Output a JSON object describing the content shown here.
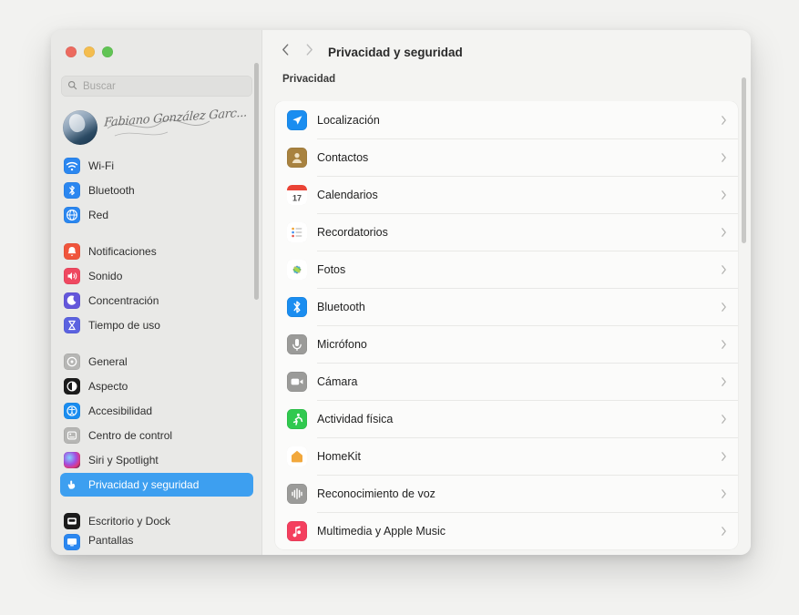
{
  "window": {
    "traffic_lights": [
      "close",
      "minimize",
      "zoom"
    ],
    "colors": {
      "close": "#ec6a5f",
      "minimize": "#f4bd4f",
      "zoom": "#61c454",
      "accent": "#3d9ff0"
    }
  },
  "sidebar": {
    "search": {
      "placeholder": "Buscar",
      "value": ""
    },
    "account": {
      "name": "Fabiano González Garc...",
      "avatar": "user-photo"
    },
    "groups": [
      {
        "items": [
          {
            "label": "Wi-Fi",
            "icon": "wifi-icon"
          },
          {
            "label": "Bluetooth",
            "icon": "bluetooth-icon"
          },
          {
            "label": "Red",
            "icon": "network-globe-icon"
          }
        ]
      },
      {
        "items": [
          {
            "label": "Notificaciones",
            "icon": "notifications-icon"
          },
          {
            "label": "Sonido",
            "icon": "sound-icon"
          },
          {
            "label": "Concentración",
            "icon": "focus-moon-icon"
          },
          {
            "label": "Tiempo de uso",
            "icon": "screen-time-icon"
          }
        ]
      },
      {
        "items": [
          {
            "label": "General",
            "icon": "general-gear-icon"
          },
          {
            "label": "Aspecto",
            "icon": "appearance-icon"
          },
          {
            "label": "Accesibilidad",
            "icon": "accessibility-icon"
          },
          {
            "label": "Centro de control",
            "icon": "control-center-icon"
          },
          {
            "label": "Siri y Spotlight",
            "icon": "siri-icon"
          },
          {
            "label": "Privacidad y seguridad",
            "icon": "privacy-hand-icon",
            "selected": true
          }
        ]
      },
      {
        "items": [
          {
            "label": "Escritorio y Dock",
            "icon": "desktop-dock-icon"
          },
          {
            "label": "Pantallas",
            "icon": "displays-icon"
          }
        ]
      }
    ]
  },
  "toolbar": {
    "back": "back-chevron",
    "forward": "forward-chevron",
    "title": "Privacidad y seguridad"
  },
  "main": {
    "section_title": "Privacidad",
    "rows": [
      {
        "label": "Localización",
        "icon": "location-arrow-icon"
      },
      {
        "label": "Contactos",
        "icon": "contacts-icon"
      },
      {
        "label": "Calendarios",
        "icon": "calendar-icon",
        "icon_text": "17"
      },
      {
        "label": "Recordatorios",
        "icon": "reminders-icon"
      },
      {
        "label": "Fotos",
        "icon": "photos-icon"
      },
      {
        "label": "Bluetooth",
        "icon": "bluetooth-icon"
      },
      {
        "label": "Micrófono",
        "icon": "microphone-icon"
      },
      {
        "label": "Cámara",
        "icon": "camera-icon"
      },
      {
        "label": "Actividad física",
        "icon": "fitness-icon"
      },
      {
        "label": "HomeKit",
        "icon": "homekit-icon"
      },
      {
        "label": "Reconocimiento de voz",
        "icon": "speech-recognition-icon"
      },
      {
        "label": "Multimedia y Apple Music",
        "icon": "music-icon"
      }
    ]
  }
}
